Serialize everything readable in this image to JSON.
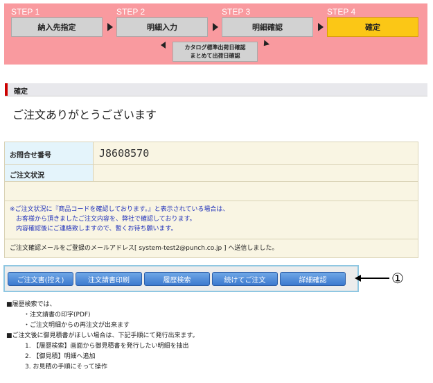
{
  "steps": [
    {
      "number": "STEP 1",
      "label": "納入先指定"
    },
    {
      "number": "STEP 2",
      "label": "明細入力"
    },
    {
      "number": "STEP 3",
      "label": "明細確認"
    },
    {
      "number": "STEP 4",
      "label": "確定"
    }
  ],
  "catalog_step": {
    "line1": "カタログ標準出荷日確認",
    "line2": "まとめて出荷日確認"
  },
  "section": {
    "title": "確定"
  },
  "thanks": "ご注文ありがとうございます",
  "info": {
    "inquiry_label": "お問合せ番号",
    "inquiry_value": "J8608570",
    "status_label": "ご注文状況",
    "notice": [
      "※ご注文状況に『商品コードを確認しております。』と表示されている場合は、",
      "お客様から頂きましたご注文内容を、弊社で確認しております。",
      "内容確認後にご連絡致しますので、暫くお待ち願います。"
    ],
    "mail_sent": "ご注文確認メールをご登録のメールアドレス[ system-test2@punch.co.jp ] へ送信しました。"
  },
  "buttons": [
    "ご注文書(控え)",
    "注文請書印刷",
    "履歴検索",
    "続けてご注文",
    "詳細確認"
  ],
  "callout": "①",
  "notes": {
    "n1": "■履歴検索では、",
    "n1a": "・注文請書の印字(PDF)",
    "n1b": "・ご注文明細からの再注文が出来ます",
    "n2": "■ご注文後に御見積書がほしい場合は、下記手順にて発行出来ます。",
    "n2a": "1. 【履歴検索】画面から御見積書を発行したい明細を抽出",
    "n2b": "2. 【御見積】明細へ追加",
    "n2c": "3. お見積の手順にそって操作"
  },
  "colors": {
    "step_bg": "#f99a9f",
    "active_step": "#fbc716",
    "button": "#4a86d8",
    "notice_text": "#2233bb"
  }
}
